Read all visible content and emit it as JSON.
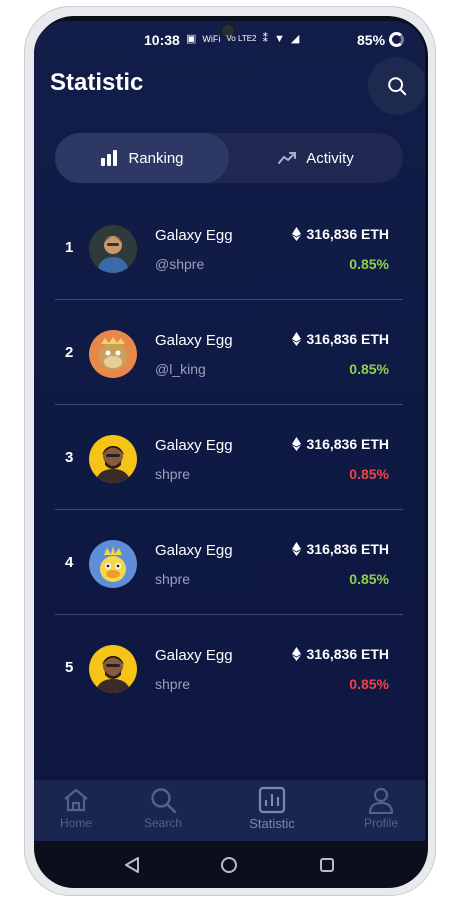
{
  "status_bar": {
    "time": "10:38",
    "icons": [
      "▣",
      "WiFi",
      "Vo LTE2",
      "⁑",
      "▼",
      "◢"
    ],
    "battery": "85%"
  },
  "header": {
    "title": "Statistic"
  },
  "tabs": [
    {
      "label": "Ranking",
      "icon": "bar-chart-icon",
      "active": true
    },
    {
      "label": "Activity",
      "icon": "trend-up-icon",
      "active": false
    }
  ],
  "rankings": [
    {
      "rank": "1",
      "name": "Galaxy Egg",
      "handle": "@shpre",
      "value": "316,836 ETH",
      "change": "0.85%",
      "change_color": "#8fd14f",
      "avatar": "cartoon-man"
    },
    {
      "rank": "2",
      "name": "Galaxy Egg",
      "handle": "@l_king",
      "value": "316,836 ETH",
      "change": "0.85%",
      "change_color": "#8fd14f",
      "avatar": "ape-nft"
    },
    {
      "rank": "3",
      "name": "Galaxy Egg",
      "handle": "shpre",
      "value": "316,836 ETH",
      "change": "0.85%",
      "change_color": "#ef4444",
      "avatar": "man-photo"
    },
    {
      "rank": "4",
      "name": "Galaxy Egg",
      "handle": "shpre",
      "value": "316,836 ETH",
      "change": "0.85%",
      "change_color": "#8fd14f",
      "avatar": "duck-nft"
    },
    {
      "rank": "5",
      "name": "Galaxy Egg",
      "handle": "shpre",
      "value": "316,836 ETH",
      "change": "0.85%",
      "change_color": "#ef4444",
      "avatar": "man-photo"
    }
  ],
  "nav": [
    {
      "label": "Home",
      "icon": "home-icon",
      "active": false
    },
    {
      "label": "Search",
      "icon": "search-icon",
      "active": false
    },
    {
      "label": "Statistic",
      "icon": "statistic-icon",
      "active": true
    },
    {
      "label": "Profile",
      "icon": "profile-icon",
      "active": false
    }
  ],
  "colors": {
    "background": "#111c47",
    "positive": "#8fd14f",
    "negative": "#ef4444",
    "accent": "#2d3964"
  }
}
